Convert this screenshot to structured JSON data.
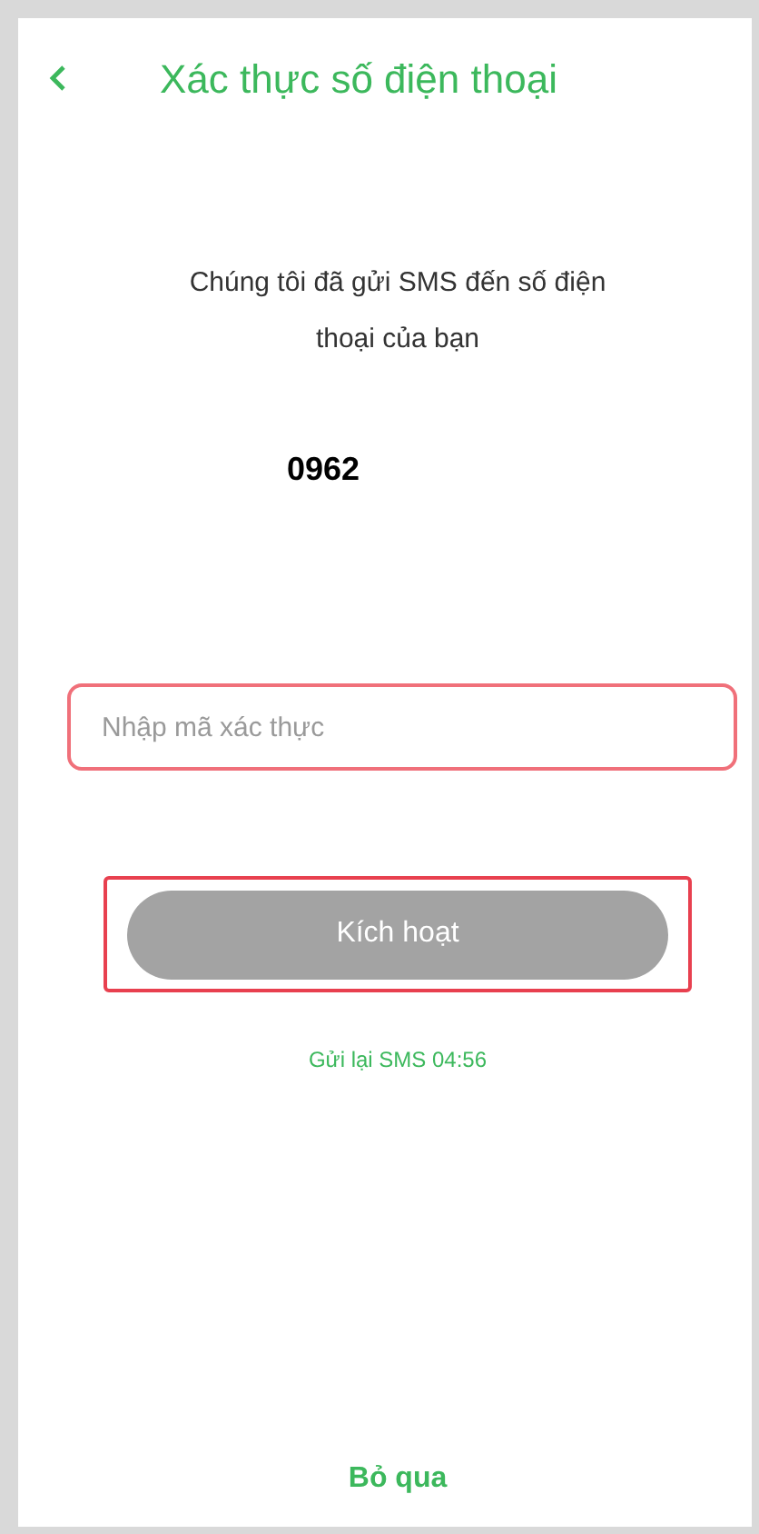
{
  "header": {
    "title": "Xác thực số điện thoại"
  },
  "message": "Chúng tôi đã gửi SMS đến số điện thoại của bạn",
  "phone": "0962",
  "code_field": {
    "placeholder": "Nhập mã xác thực",
    "highlighted": true
  },
  "activate_button": {
    "label": "Kích hoạt",
    "disabled": true,
    "highlighted": true
  },
  "resend": "Gửi lại SMS 04:56",
  "skip": "Bỏ qua"
}
